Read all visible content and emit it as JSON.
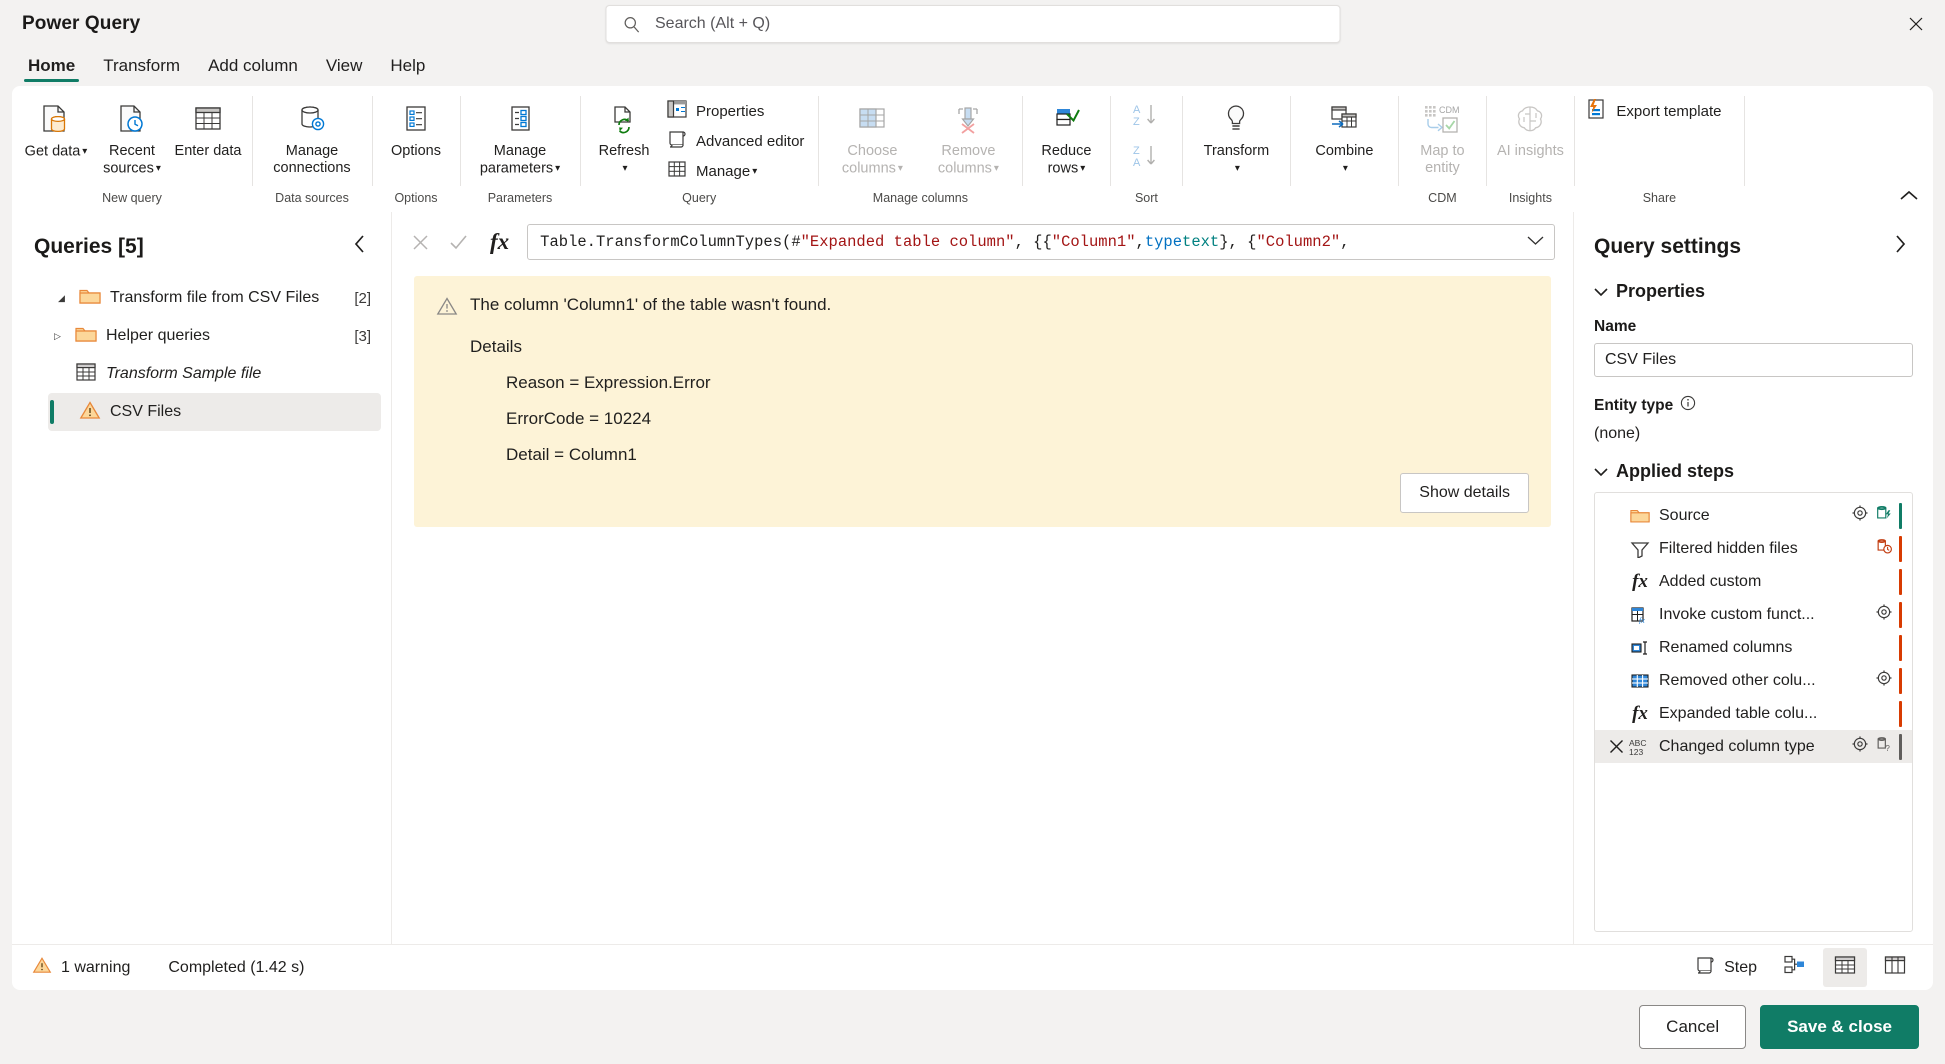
{
  "window": {
    "title": "Power Query",
    "close_icon": "close-icon"
  },
  "search": {
    "placeholder": "Search (Alt + Q)",
    "value": "",
    "icon": "search-icon"
  },
  "tabs": [
    {
      "label": "Home",
      "active": true
    },
    {
      "label": "Transform",
      "active": false
    },
    {
      "label": "Add column",
      "active": false
    },
    {
      "label": "View",
      "active": false
    },
    {
      "label": "Help",
      "active": false
    }
  ],
  "ribbon": {
    "collapse_icon": "chevron-up-icon",
    "groups": [
      {
        "name": "New query",
        "label": "New query",
        "buttons": [
          {
            "label": "Get data",
            "icon": "get-data-icon",
            "dropdown": true,
            "disabled": false
          },
          {
            "label": "Recent sources",
            "icon": "recent-sources-icon",
            "dropdown": true,
            "disabled": false
          },
          {
            "label": "Enter data",
            "icon": "enter-data-icon",
            "dropdown": false,
            "disabled": false
          }
        ]
      },
      {
        "name": "Data sources",
        "label": "Data sources",
        "buttons": [
          {
            "label": "Manage connections",
            "icon": "manage-connections-icon",
            "dropdown": false,
            "disabled": false
          }
        ]
      },
      {
        "name": "Options",
        "label": "Options",
        "buttons": [
          {
            "label": "Options",
            "icon": "options-icon",
            "dropdown": false,
            "disabled": false
          }
        ]
      },
      {
        "name": "Parameters",
        "label": "Parameters",
        "buttons": [
          {
            "label": "Manage parameters",
            "icon": "manage-parameters-icon",
            "dropdown": true,
            "disabled": false
          }
        ]
      },
      {
        "name": "Query",
        "label": "Query",
        "buttons": [
          {
            "label": "Refresh",
            "icon": "refresh-icon",
            "dropdown": true,
            "disabled": false
          }
        ],
        "small_buttons": [
          {
            "label": "Properties",
            "icon": "properties-icon",
            "dropdown": false
          },
          {
            "label": "Advanced editor",
            "icon": "advanced-editor-icon",
            "dropdown": false
          },
          {
            "label": "Manage",
            "icon": "manage-icon",
            "dropdown": true
          }
        ]
      },
      {
        "name": "Manage columns",
        "label": "Manage columns",
        "buttons": [
          {
            "label": "Choose columns",
            "icon": "choose-columns-icon",
            "dropdown": true,
            "disabled": true
          },
          {
            "label": "Remove columns",
            "icon": "remove-columns-icon",
            "dropdown": true,
            "disabled": true
          }
        ]
      },
      {
        "name": "Reduce rows",
        "label": "",
        "buttons": [
          {
            "label": "Reduce rows",
            "icon": "reduce-rows-icon",
            "dropdown": true,
            "disabled": false
          }
        ]
      },
      {
        "name": "Sort",
        "label": "Sort",
        "buttons": [
          {
            "label": "Sort ascending",
            "icon": "sort-az-icon",
            "dropdown": false,
            "disabled": true
          },
          {
            "label": "Sort descending",
            "icon": "sort-za-icon",
            "dropdown": false,
            "disabled": true
          }
        ]
      },
      {
        "name": "Transform",
        "label": "",
        "buttons": [
          {
            "label": "Transform",
            "icon": "transform-icon",
            "dropdown": true,
            "disabled": false
          }
        ]
      },
      {
        "name": "Combine",
        "label": "",
        "buttons": [
          {
            "label": "Combine",
            "icon": "combine-icon",
            "dropdown": true,
            "disabled": false
          }
        ]
      },
      {
        "name": "CDM",
        "label": "CDM",
        "buttons": [
          {
            "label": "Map to entity",
            "icon": "map-to-entity-icon",
            "dropdown": false,
            "disabled": true
          }
        ]
      },
      {
        "name": "Insights",
        "label": "Insights",
        "buttons": [
          {
            "label": "AI insights",
            "icon": "ai-insights-icon",
            "dropdown": false,
            "disabled": true
          }
        ]
      },
      {
        "name": "Share",
        "label": "Share",
        "small_buttons": [
          {
            "label": "Export template",
            "icon": "export-template-icon",
            "dropdown": false
          }
        ]
      }
    ]
  },
  "queries_panel": {
    "title": "Queries [5]",
    "collapse_icon": "chevron-left-icon",
    "items": [
      {
        "label": "Transform file from CSV Files",
        "count": "[2]",
        "icon": "folder-icon",
        "expanded": true,
        "level": 0,
        "selected": false,
        "italic": false
      },
      {
        "label": "Helper queries",
        "count": "[3]",
        "icon": "folder-icon",
        "expanded": false,
        "level": 1,
        "selected": false,
        "italic": false
      },
      {
        "label": "Transform Sample file",
        "count": "",
        "icon": "table-icon",
        "expanded": null,
        "level": 1,
        "selected": false,
        "italic": true
      },
      {
        "label": "CSV Files",
        "count": "",
        "icon": "warning-icon",
        "expanded": null,
        "level": 0,
        "selected": true,
        "italic": false
      }
    ]
  },
  "formula_bar": {
    "cancel_icon": "cancel-icon",
    "accept_icon": "checkmark-icon",
    "fx_icon": "fx-icon",
    "expand_icon": "chevron-down-icon",
    "tokens": [
      {
        "text": "Table.TransformColumnTypes(#",
        "cls": "tok-pln"
      },
      {
        "text": "\"Expanded table column\"",
        "cls": "tok-str"
      },
      {
        "text": ", {{",
        "cls": "tok-pln"
      },
      {
        "text": "\"Column1\"",
        "cls": "tok-str"
      },
      {
        "text": ", ",
        "cls": "tok-pln"
      },
      {
        "text": "type",
        "cls": "tok-kw"
      },
      {
        "text": " ",
        "cls": "tok-pln"
      },
      {
        "text": "text",
        "cls": "tok-type"
      },
      {
        "text": "}, {",
        "cls": "tok-pln"
      },
      {
        "text": "\"Column2\"",
        "cls": "tok-str"
      },
      {
        "text": ",",
        "cls": "tok-pln"
      }
    ],
    "full_text": "Table.TransformColumnTypes(#\"Expanded table column\", {{\"Column1\", type text}, {\"Column2\","
  },
  "error": {
    "icon": "warning-icon",
    "message": "The column 'Column1' of the table wasn't found.",
    "details_label": "Details",
    "detail_lines": [
      "Reason = Expression.Error",
      "ErrorCode = 10224",
      "Detail = Column1"
    ],
    "show_details_button": "Show details",
    "background_color": "#fdf3d7"
  },
  "query_settings": {
    "title": "Query settings",
    "collapse_icon": "chevron-right-icon",
    "properties": {
      "section_label": "Properties",
      "expanded": true,
      "name_label": "Name",
      "name_value": "CSV Files",
      "entity_type_label": "Entity type",
      "entity_type_info_icon": "info-icon",
      "entity_type_value": "(none)"
    },
    "applied_steps": {
      "section_label": "Applied steps",
      "expanded": true,
      "steps": [
        {
          "label": "Source",
          "icon": "folder-icon",
          "gear": true,
          "badge": "data-source-settings-icon",
          "bar": "#107c66",
          "selected": false,
          "delete": false
        },
        {
          "label": "Filtered hidden files",
          "icon": "filter-icon",
          "gear": false,
          "badge": "query-folding-icon",
          "bar": "#d83b01",
          "selected": false,
          "delete": false
        },
        {
          "label": "Added custom",
          "icon": "fx-icon",
          "gear": false,
          "badge": "",
          "bar": "#d83b01",
          "selected": false,
          "delete": false
        },
        {
          "label": "Invoke custom funct...",
          "icon": "invoke-function-icon",
          "gear": true,
          "badge": "",
          "bar": "#d83b01",
          "selected": false,
          "delete": false
        },
        {
          "label": "Renamed columns",
          "icon": "rename-columns-icon",
          "gear": false,
          "badge": "",
          "bar": "#d83b01",
          "selected": false,
          "delete": false
        },
        {
          "label": "Removed other colu...",
          "icon": "removed-other-columns-icon",
          "gear": true,
          "badge": "",
          "bar": "#d83b01",
          "selected": false,
          "delete": false
        },
        {
          "label": "Expanded table colu...",
          "icon": "fx-icon",
          "gear": false,
          "badge": "",
          "bar": "#d83b01",
          "selected": false,
          "delete": false
        },
        {
          "label": "Changed column type",
          "icon": "abc123-icon",
          "gear": true,
          "badge": "query-folding-unknown-icon",
          "bar": "#605e5c",
          "selected": true,
          "delete": true
        }
      ]
    }
  },
  "status_bar": {
    "warning_icon": "warning-icon",
    "warning_text": "1 warning",
    "completed_text": "Completed (1.42 s)",
    "step_label": "Step",
    "step_icon": "step-icon",
    "diagram_view_icon": "diagram-view-icon",
    "data-view_icon": "data-view-icon",
    "schema_view_icon": "schema-view-icon"
  },
  "footer": {
    "cancel_label": "Cancel",
    "save_close_label": "Save & close",
    "primary_color": "#107c66"
  }
}
